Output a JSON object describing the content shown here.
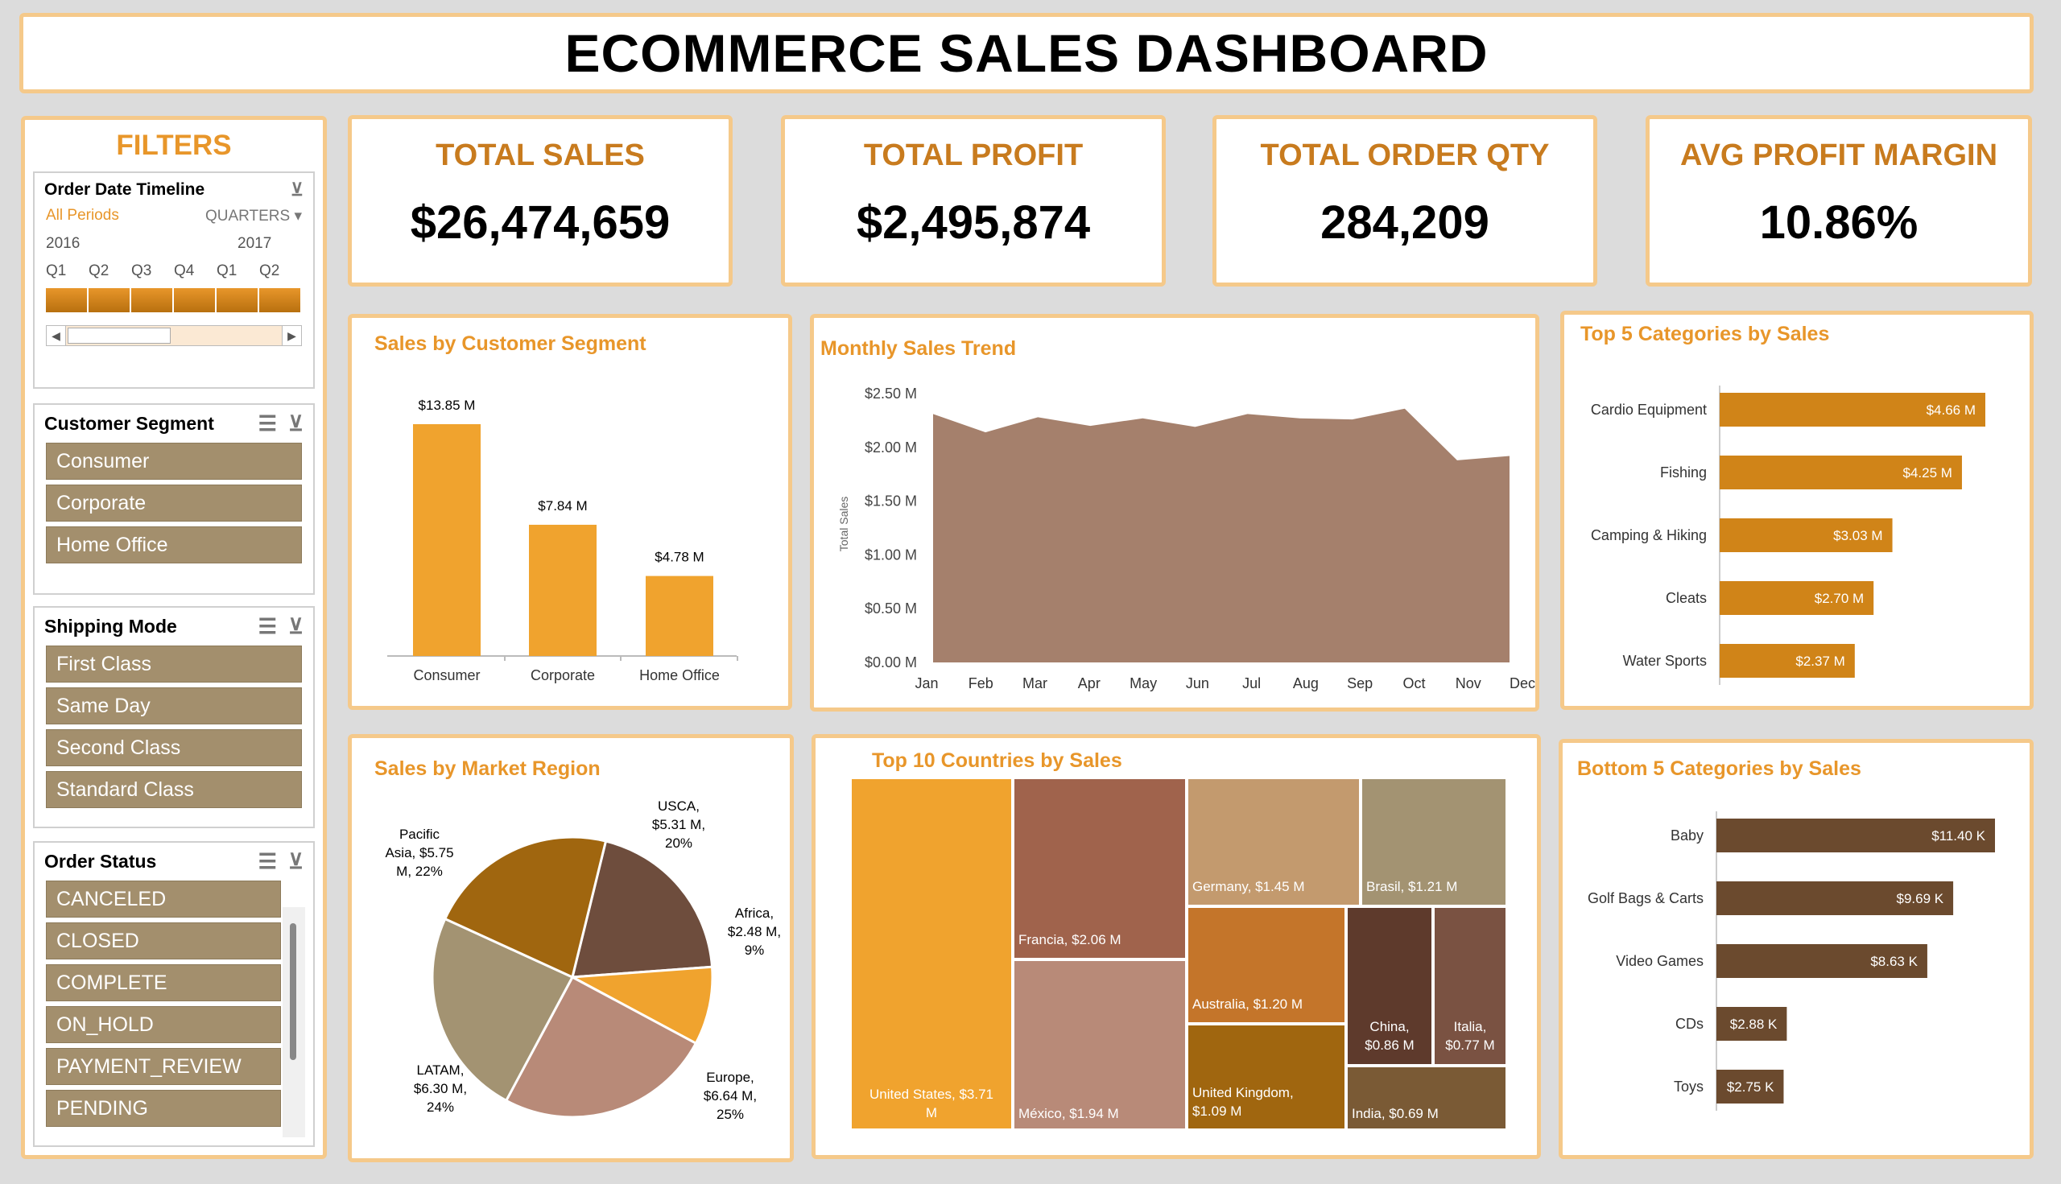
{
  "title": "ECOMMERCE SALES DASHBOARD",
  "kpis": [
    {
      "label": "TOTAL SALES",
      "value": "$26,474,659"
    },
    {
      "label": "TOTAL PROFIT",
      "value": "$2,495,874"
    },
    {
      "label": "TOTAL ORDER QTY",
      "value": "284,209"
    },
    {
      "label": "AVG PROFIT MARGIN",
      "value": "10.86%"
    }
  ],
  "filters": {
    "title": "FILTERS",
    "timeline": {
      "title": "Order Date Timeline",
      "all_periods": "All Periods",
      "granularity": "QUARTERS",
      "years": [
        "2016",
        "2017"
      ],
      "quarters": [
        "Q1",
        "Q2",
        "Q3",
        "Q4",
        "Q1",
        "Q2"
      ]
    },
    "segment": {
      "title": "Customer Segment",
      "items": [
        "Consumer",
        "Corporate",
        "Home Office"
      ]
    },
    "shipping": {
      "title": "Shipping Mode",
      "items": [
        "First Class",
        "Same Day",
        "Second Class",
        "Standard Class"
      ]
    },
    "status": {
      "title": "Order Status",
      "items": [
        "CANCELED",
        "CLOSED",
        "COMPLETE",
        "ON_HOLD",
        "PAYMENT_REVIEW",
        "PENDING"
      ]
    }
  },
  "colors": {
    "accent": "#e8962a",
    "panel_border": "#f5c98a",
    "slicer_item": "#a38f6d",
    "area": "#a5806c",
    "brown": "#6b4a2e",
    "orange_bar": "#d08418"
  },
  "chart_data": [
    {
      "type": "bar",
      "title": "Sales by Customer Segment",
      "categories": [
        "Consumer",
        "Corporate",
        "Home Office"
      ],
      "values": [
        13.85,
        7.84,
        4.78
      ],
      "labels": [
        "$13.85 M",
        "$7.84 M",
        "$4.78 M"
      ],
      "ylim": [
        0,
        15
      ]
    },
    {
      "type": "area",
      "title": "Monthly Sales Trend",
      "ylabel": "Total Sales",
      "x": [
        "Jan",
        "Feb",
        "Mar",
        "Apr",
        "May",
        "Jun",
        "Jul",
        "Aug",
        "Sep",
        "Oct",
        "Nov",
        "Dec"
      ],
      "values": [
        2.31,
        2.14,
        2.28,
        2.2,
        2.27,
        2.19,
        2.31,
        2.27,
        2.26,
        2.36,
        1.88,
        1.92
      ],
      "yticks": [
        "$0.00 M",
        "$0.50 M",
        "$1.00 M",
        "$1.50 M",
        "$2.00 M",
        "$2.50 M"
      ],
      "ylim": [
        0,
        2.5
      ]
    },
    {
      "type": "bar",
      "title": "Top 5 Categories by Sales",
      "categories": [
        "Cardio Equipment",
        "Fishing",
        "Camping & Hiking",
        "Cleats",
        "Water Sports"
      ],
      "values": [
        4.66,
        4.25,
        3.03,
        2.7,
        2.37
      ],
      "labels": [
        "$4.66 M",
        "$4.25 M",
        "$3.03 M",
        "$2.70 M",
        "$2.37 M"
      ]
    },
    {
      "type": "pie",
      "title": "Sales by Market Region",
      "slices": [
        {
          "name": "USCA",
          "value": 20,
          "label": [
            "USCA,",
            "$5.31 M,",
            "20%"
          ]
        },
        {
          "name": "Africa",
          "value": 9,
          "label": [
            "Africa,",
            "$2.48 M,",
            "9%"
          ]
        },
        {
          "name": "Europe",
          "value": 25,
          "label": [
            "Europe,",
            "$6.64 M,",
            "25%"
          ]
        },
        {
          "name": "LATAM",
          "value": 24,
          "label": [
            "LATAM,",
            "$6.30 M,",
            "24%"
          ]
        },
        {
          "name": "Pacific Asia",
          "value": 22,
          "label": [
            "Pacific",
            "Asia, $5.75",
            "M, 22%"
          ]
        }
      ]
    },
    {
      "type": "treemap",
      "title": "Top 10 Countries by Sales",
      "items": [
        {
          "name": "United States",
          "value": 3.71,
          "label": "United States, $3.71 M"
        },
        {
          "name": "Francia",
          "value": 2.06,
          "label": "Francia, $2.06 M"
        },
        {
          "name": "México",
          "value": 1.94,
          "label": "México, $1.94 M"
        },
        {
          "name": "Germany",
          "value": 1.45,
          "label": "Germany, $1.45 M"
        },
        {
          "name": "Brasil",
          "value": 1.21,
          "label": "Brasil, $1.21 M"
        },
        {
          "name": "Australia",
          "value": 1.2,
          "label": "Australia, $1.20 M"
        },
        {
          "name": "United Kingdom",
          "value": 1.09,
          "label": "United Kingdom, $1.09 M"
        },
        {
          "name": "China",
          "value": 0.86,
          "label": "China, $0.86 M"
        },
        {
          "name": "Italia",
          "value": 0.77,
          "label": "Italia, $0.77 M"
        },
        {
          "name": "India",
          "value": 0.69,
          "label": "India, $0.69 M"
        }
      ]
    },
    {
      "type": "bar",
      "title": "Bottom 5 Categories by Sales",
      "categories": [
        "Baby",
        "Golf Bags & Carts",
        "Video Games",
        "CDs",
        "Toys"
      ],
      "values": [
        11.4,
        9.69,
        8.63,
        2.88,
        2.75
      ],
      "labels": [
        "$11.40 K",
        "$9.69 K",
        "$8.63 K",
        "$2.88 K",
        "$2.75 K"
      ]
    }
  ]
}
